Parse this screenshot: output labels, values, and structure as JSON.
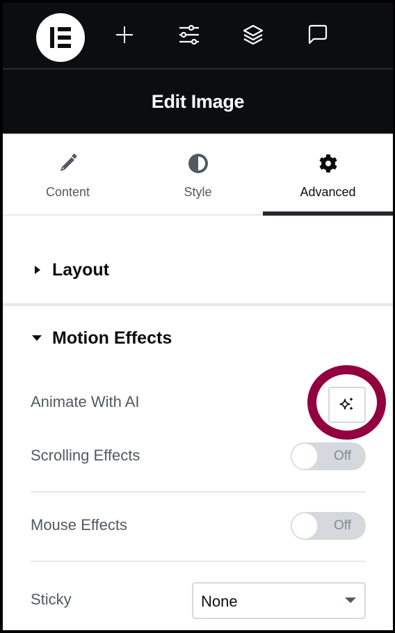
{
  "topbar": {
    "logo": "elementor-logo",
    "icons": [
      {
        "name": "add-icon",
        "label": "Add Element"
      },
      {
        "name": "site-settings-icon",
        "label": "Site Settings"
      },
      {
        "name": "structure-layers-icon",
        "label": "Structure"
      },
      {
        "name": "notes-comment-icon",
        "label": "Notes"
      }
    ]
  },
  "header": {
    "title": "Edit Image"
  },
  "tabs": [
    {
      "label": "Content",
      "icon": "pencil-icon",
      "active": false
    },
    {
      "label": "Style",
      "icon": "contrast-half-circle-icon",
      "active": false
    },
    {
      "label": "Advanced",
      "icon": "gear-icon",
      "active": true
    }
  ],
  "sections": {
    "layout": {
      "title": "Layout",
      "expanded": false
    },
    "motion_effects": {
      "title": "Motion Effects",
      "expanded": true
    }
  },
  "controls": {
    "animate_ai": {
      "label": "Animate With AI",
      "icon": "ai-sparkle-icon"
    },
    "scrolling_effects": {
      "label": "Scrolling Effects",
      "state": "Off"
    },
    "mouse_effects": {
      "label": "Mouse Effects",
      "state": "Off"
    },
    "sticky": {
      "label": "Sticky",
      "value": "None"
    }
  },
  "colors": {
    "highlight": "#93003f",
    "dark": "#0c0d0e",
    "muted_text": "#515962"
  }
}
